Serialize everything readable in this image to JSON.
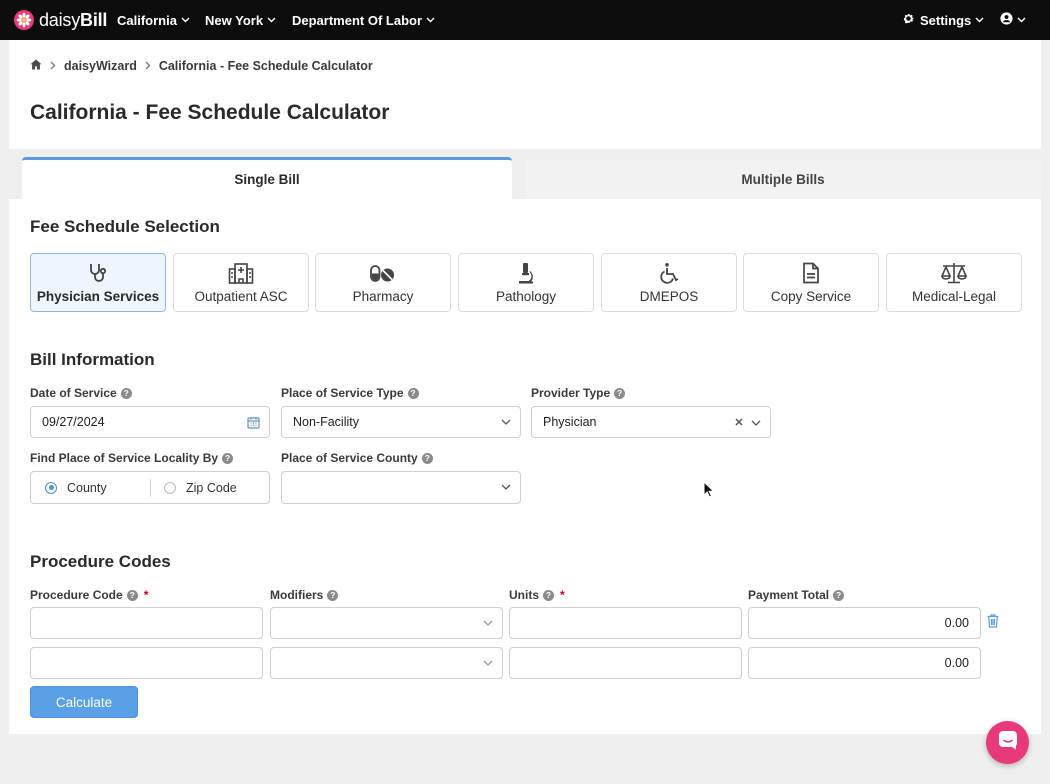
{
  "nav": {
    "brand": {
      "prefix": "daisy",
      "bold": "Bill"
    },
    "items": [
      {
        "label": "California"
      },
      {
        "label": "New York"
      },
      {
        "label": "Department Of Labor"
      }
    ],
    "settings_label": "Settings",
    "colors": {
      "bar": "#0d0d0d",
      "logo": "#e8397b"
    }
  },
  "breadcrumb": {
    "home_icon": "home-icon",
    "items": [
      "daisyWizard",
      "California - Fee Schedule Calculator"
    ]
  },
  "page_title": "California - Fee Schedule Calculator",
  "tabs": [
    {
      "label": "Single Bill",
      "active": true
    },
    {
      "label": "Multiple Bills",
      "active": false
    }
  ],
  "fee_schedule": {
    "title": "Fee Schedule Selection",
    "options": [
      {
        "label": "Physician Services",
        "icon": "stethoscope-icon",
        "active": true
      },
      {
        "label": "Outpatient ASC",
        "icon": "hospital-icon",
        "active": false
      },
      {
        "label": "Pharmacy",
        "icon": "pills-icon",
        "active": false
      },
      {
        "label": "Pathology",
        "icon": "microscope-icon",
        "active": false
      },
      {
        "label": "DMEPOS",
        "icon": "wheelchair-icon",
        "active": false
      },
      {
        "label": "Copy Service",
        "icon": "document-icon",
        "active": false
      },
      {
        "label": "Medical-Legal",
        "icon": "scales-icon",
        "active": false
      }
    ]
  },
  "bill_info": {
    "title": "Bill Information",
    "date_of_service": {
      "label": "Date of Service",
      "value": "09/27/2024"
    },
    "place_of_service_type": {
      "label": "Place of Service Type",
      "value": "Non-Facility"
    },
    "provider_type": {
      "label": "Provider Type",
      "value": "Physician"
    },
    "find_locality": {
      "label": "Find Place of Service Locality By",
      "options": [
        "County",
        "Zip Code"
      ],
      "selected": "County"
    },
    "county": {
      "label": "Place of Service County",
      "value": ""
    }
  },
  "procedure_codes": {
    "title": "Procedure Codes",
    "columns": [
      "Procedure Code",
      "Modifiers",
      "Units",
      "Payment Total"
    ],
    "rows": [
      {
        "code": "",
        "modifiers": "",
        "units": "",
        "payment_total": "0.00"
      },
      {
        "code": "",
        "modifiers": "",
        "units": "",
        "payment_total": "0.00"
      }
    ]
  },
  "actions": {
    "calculate_label": "Calculate"
  },
  "accent_colors": {
    "primary": "#5aa0e6",
    "required": "#d0021b",
    "chat": "#e8397b"
  }
}
